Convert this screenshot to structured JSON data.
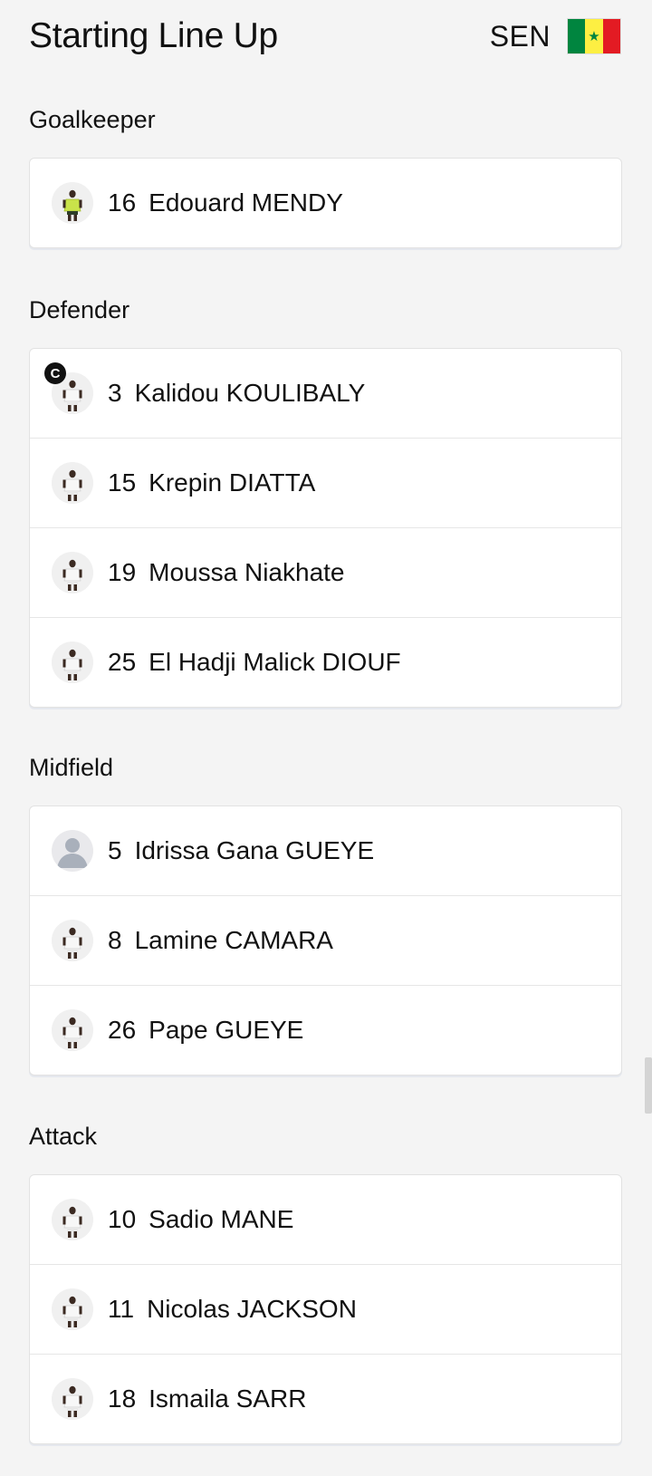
{
  "header": {
    "title": "Starting Line Up",
    "team_code": "SEN"
  },
  "colors": {
    "flag_green": "#00853f",
    "flag_yellow": "#fdef42",
    "flag_red": "#e31b23"
  },
  "sections": [
    {
      "title": "Goalkeeper",
      "players": [
        {
          "number": "16",
          "name": "Edouard MENDY",
          "kit": "yellow"
        }
      ]
    },
    {
      "title": "Defender",
      "players": [
        {
          "number": "3",
          "name": "Kalidou KOULIBALY",
          "kit": "white",
          "captain": "C"
        },
        {
          "number": "15",
          "name": "Krepin DIATTA",
          "kit": "white"
        },
        {
          "number": "19",
          "name": "Moussa Niakhate",
          "kit": "white"
        },
        {
          "number": "25",
          "name": "El Hadji Malick DIOUF",
          "kit": "white"
        }
      ]
    },
    {
      "title": "Midfield",
      "players": [
        {
          "number": "5",
          "name": "Idrissa Gana GUEYE",
          "kit": "placeholder"
        },
        {
          "number": "8",
          "name": "Lamine CAMARA",
          "kit": "white"
        },
        {
          "number": "26",
          "name": "Pape GUEYE",
          "kit": "white"
        }
      ]
    },
    {
      "title": "Attack",
      "players": [
        {
          "number": "10",
          "name": "Sadio MANE",
          "kit": "white"
        },
        {
          "number": "11",
          "name": "Nicolas JACKSON",
          "kit": "white"
        },
        {
          "number": "18",
          "name": "Ismaila SARR",
          "kit": "white"
        }
      ]
    }
  ]
}
